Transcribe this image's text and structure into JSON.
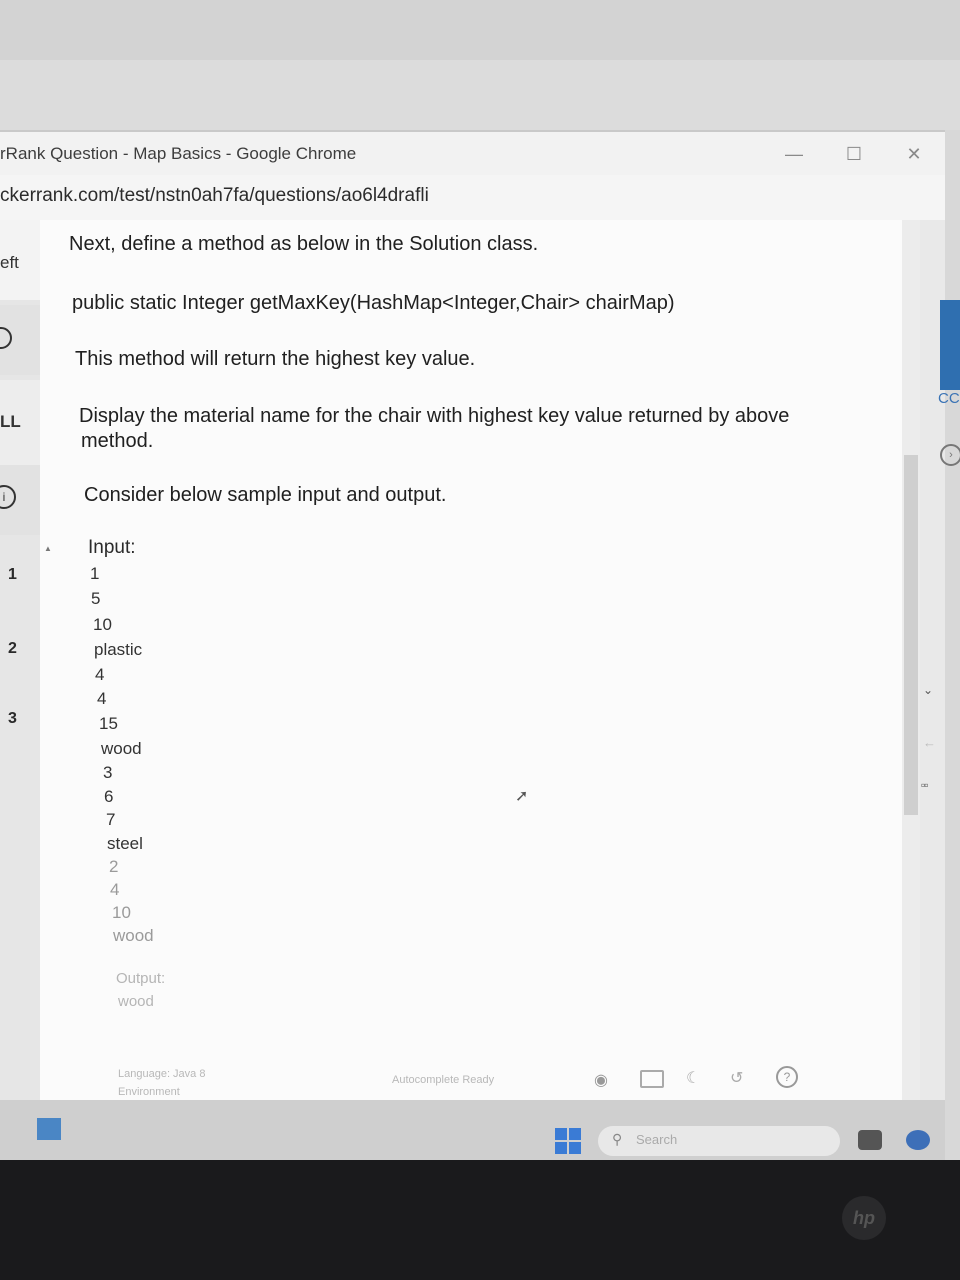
{
  "window": {
    "title": "rRank Question - Map Basics - Google Chrome",
    "controls": {
      "minimize": "—",
      "maximize": "☐",
      "close": "✕"
    }
  },
  "address_bar": {
    "url": "ckerrank.com/test/nstn0ah7fa/questions/ao6l4drafli"
  },
  "left_sidebar": {
    "tab_label": "eft",
    "tab2_label": "LL",
    "line_numbers": [
      "1",
      "2",
      "3"
    ]
  },
  "right_panel": {
    "label": "CC"
  },
  "question": {
    "p1": "Next, define a method as below in the Solution class.",
    "signature": "public static Integer getMaxKey(HashMap<Integer,Chair> chairMap)",
    "p2": "This method will return the highest key value.",
    "p3_line1": "Display the material name for the chair with highest key value returned by above",
    "p3_line2": "method.",
    "p4": "Consider below sample input and output.",
    "input_label": "Input:",
    "input_lines": [
      "1",
      "5",
      "10",
      "plastic",
      "4",
      "4",
      "15",
      "wood",
      "3",
      "6",
      "7",
      "steel",
      "2",
      "4",
      "10",
      "wood"
    ],
    "output_label": "Output:",
    "output_value": "wood"
  },
  "status_bar": {
    "language": "Language: Java 8",
    "environment": "Environment",
    "autocomplete": "Autocomplete Ready"
  },
  "taskbar": {
    "search_placeholder": "Search"
  },
  "brand": {
    "laptop_logo": "hp"
  }
}
